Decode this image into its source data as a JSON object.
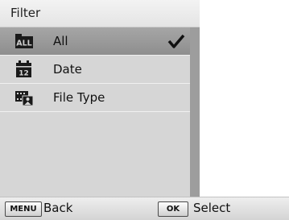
{
  "header": {
    "title": "Filter"
  },
  "filter_options": [
    {
      "label": "All",
      "icon": "all-files-icon",
      "icon_text": "ALL",
      "selected": true
    },
    {
      "label": "Date",
      "icon": "calendar-icon",
      "icon_text": "12",
      "selected": false
    },
    {
      "label": "File Type",
      "icon": "file-type-icon",
      "selected": false
    }
  ],
  "selected_indicator": "checkmark-icon",
  "footer": {
    "menu_key": "MENU",
    "back_label": "Back",
    "ok_key": "OK",
    "select_label": "Select"
  },
  "colors": {
    "selected_row": "#9a9a9a",
    "list_background": "#d6d6d6",
    "scrollbar": "#bdbdbd"
  }
}
